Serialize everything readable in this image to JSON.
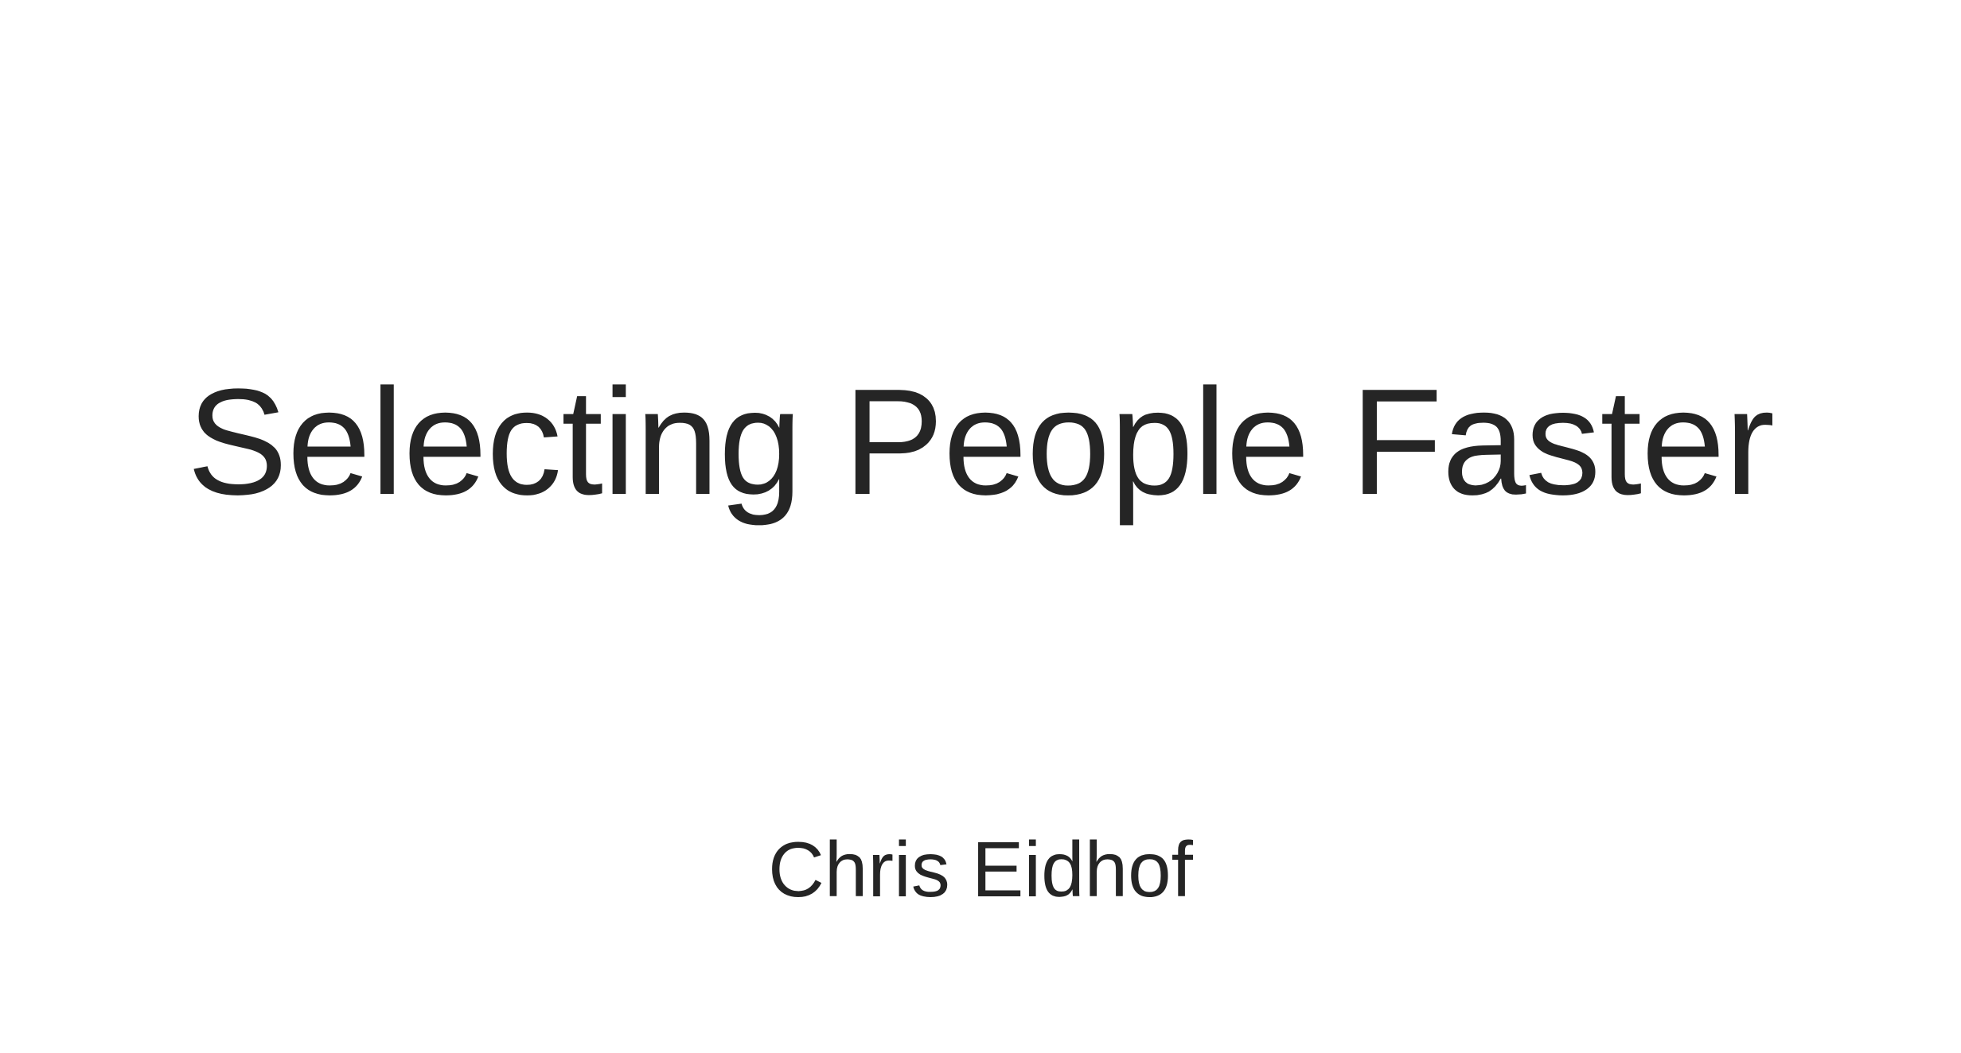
{
  "slide": {
    "title": "Selecting People Faster",
    "author": "Chris Eidhof"
  },
  "colors": {
    "background": "#ffffff",
    "text": "#252525"
  }
}
